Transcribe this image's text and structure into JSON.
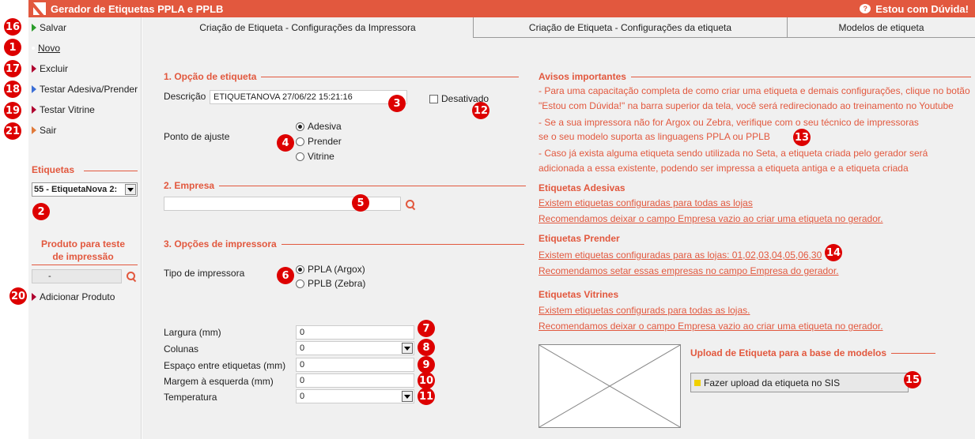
{
  "app": {
    "title": "Gerador de Etiquetas PPLA e PPLB",
    "help_label": "Estou com Dúvida!"
  },
  "sidebar": {
    "items": [
      {
        "label": "Salvar"
      },
      {
        "label": "Novo"
      },
      {
        "label": "Excluir"
      },
      {
        "label": "Testar Adesiva/Prender"
      },
      {
        "label": "Testar Vitrine"
      },
      {
        "label": "Sair"
      }
    ],
    "etiquetas_heading": "Etiquetas",
    "etiquetas_selected": "55 - EtiquetaNova 2:",
    "produto_heading_1": "Produto para teste",
    "produto_heading_2": "de impressão",
    "produto_value": "-",
    "add_product": "Adicionar Produto"
  },
  "tabs": [
    {
      "label": "Criação de Etiqueta - Configurações da Impressora"
    },
    {
      "label": "Criação de Etiqueta - Configurações da etiqueta"
    },
    {
      "label": "Modelos de etiqueta"
    }
  ],
  "section1": {
    "title": "1. Opção de etiqueta",
    "descricao_label": "Descrição",
    "descricao_value": "ETIQUETANOVA 27/06/22 15:21:16",
    "desativado_label": "Desativado",
    "ponto_label": "Ponto de ajuste",
    "ponto_options": [
      "Adesiva",
      "Prender",
      "Vitrine"
    ]
  },
  "section2": {
    "title": "2. Empresa",
    "empresa_value": ""
  },
  "section3": {
    "title": "3. Opções de impressora",
    "tipo_label": "Tipo de impressora",
    "tipo_options": [
      "PPLA (Argox)",
      "PPLB (Zebra)"
    ]
  },
  "dimensions": [
    {
      "label": "Largura (mm)",
      "value": "0"
    },
    {
      "label": "Colunas",
      "value": "0"
    },
    {
      "label": "Espaço entre etiquetas (mm)",
      "value": "0"
    },
    {
      "label": "Margem à esquerda (mm)",
      "value": "0"
    },
    {
      "label": "Temperatura",
      "value": "0"
    }
  ],
  "avisos": {
    "title": "Avisos importantes",
    "lines": [
      "- Para uma capacitação completa de como criar uma etiqueta e demais configurações, clique no botão",
      "\"Estou com Dúvida!\" na barra superior da tela, você será redirecionado ao treinamento no Youtube",
      "- Se a sua impressora não for Argox ou Zebra, verifique com o seu técnico de impressoras",
      "se o seu modelo suporta as linguagens PPLA ou PPLB",
      "- Caso já exista alguma etiqueta sendo utilizada no Seta, a etiqueta criada pelo gerador será",
      "adicionada a essa existente, podendo ser impressa a etiqueta antiga e a etiqueta criada"
    ]
  },
  "adesivas": {
    "title": "Etiquetas Adesivas",
    "link1": "Existem etiquetas configuradas para todas as lojas",
    "link2": "Recomendamos deixar o campo Empresa vazio ao criar uma etiqueta no gerador."
  },
  "prender": {
    "title": "Etiquetas Prender",
    "link1": "Existem etiquetas configuradas para as lojas: 01,02,03,04,05,06,30",
    "link2": "Recomendamos setar essas empresas no campo Empresa do gerador."
  },
  "vitrines": {
    "title": "Etiquetas Vitrines",
    "link1": "Existem etiquetas configurads para todas as lojas.",
    "link2": "Recomendamos deixar o campo Empresa vazio ao criar uma etiqueta no gerador."
  },
  "upload": {
    "title": "Upload de Etiqueta para a base de modelos",
    "button": "Fazer upload da etiqueta no SIS"
  },
  "badges": [
    "16",
    "1",
    "17",
    "18",
    "19",
    "21",
    "2",
    "20",
    "3",
    "12",
    "4",
    "5",
    "6",
    "7",
    "8",
    "9",
    "10",
    "11",
    "13",
    "14",
    "15"
  ]
}
